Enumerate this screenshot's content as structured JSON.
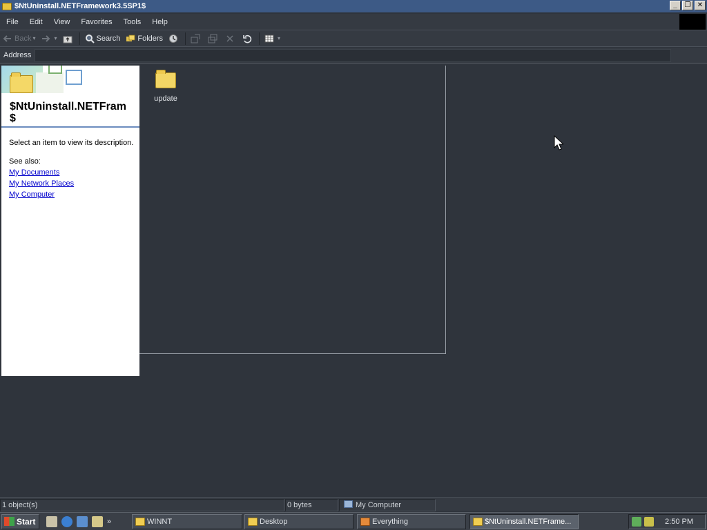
{
  "window": {
    "title": "$NtUninstall.NETFramework3.5SP1$",
    "controls": {
      "minimize": "_",
      "restore": "❐",
      "close": "✕"
    }
  },
  "menubar": {
    "items": [
      "File",
      "Edit",
      "View",
      "Favorites",
      "Tools",
      "Help"
    ]
  },
  "toolbar": {
    "back": "Back",
    "search": "Search",
    "folders": "Folders"
  },
  "addressbar": {
    "label": "Address",
    "value": ""
  },
  "webpanel": {
    "title_line1": "$NtUninstall.NETFram",
    "title_line2": "$",
    "description": "Select an item to view its description.",
    "see_also": "See also:",
    "links": [
      "My Documents",
      "My Network Places",
      "My Computer"
    ]
  },
  "content": {
    "items": [
      {
        "name": "update",
        "icon": "folder-icon"
      }
    ]
  },
  "statusbar": {
    "objects": "1 object(s)",
    "size": "0 bytes",
    "zone": "My Computer"
  },
  "taskbar": {
    "start": "Start",
    "tasks": [
      "WINNT",
      "Desktop",
      "Everything",
      "$NtUninstall.NETFrame..."
    ],
    "clock": "2:50 PM",
    "more": "»"
  },
  "colors": {
    "titlebar": "#3d5a86",
    "background": "#2f343c",
    "link": "#0000cc"
  }
}
